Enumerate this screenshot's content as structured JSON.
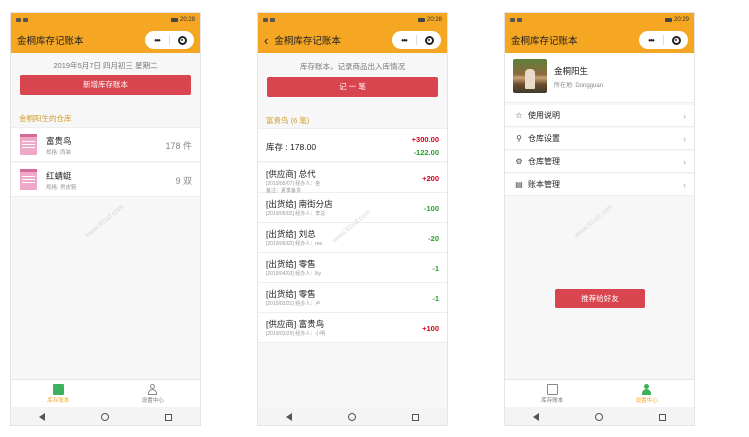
{
  "status_bar": {
    "carrier_glyphs": "⊡ ᵢₗ ≋",
    "right_glyphs": "⏰ ✱ ▮",
    "screen1_time": "20:28",
    "screen2_time": "20:28",
    "screen3_time": "20:29"
  },
  "capsule": {
    "more": "•••",
    "close_icon": "target-circle"
  },
  "screen1": {
    "title": "金桐库存记账本",
    "date": "2019年5月7日 四月初三 星期二",
    "add_button": "新增库存账本",
    "section": "金桐阳生的仓库",
    "items": [
      {
        "name": "富贵鸟",
        "spec": "规格: 西装",
        "qty": "178 件"
      },
      {
        "name": "红蜻蜓",
        "spec": "规格: 男皮鞋",
        "qty": "9 双"
      }
    ]
  },
  "screen2": {
    "title": "金桐库存记账本",
    "intro": "库存账本，记录商品出入库情况",
    "record_button": "记 一 笔",
    "section": "富贵鸟 (6 笔)",
    "stock_label": "库存 : 178.00",
    "stock_in": "+300.00",
    "stock_out": "-122.00",
    "records": [
      {
        "title": "[供应商] 总代",
        "meta": "[2019/05/07] 经办人：金",
        "meta2": "备注：夏季备货",
        "qty": "+200",
        "dir": "pos"
      },
      {
        "title": "[出货给] 南街分店",
        "meta": "[2019/05/02] 经办人：李总",
        "meta2": "",
        "qty": "-100",
        "dir": "neg"
      },
      {
        "title": "[出货给] 刘总",
        "meta": "[2019/05/02] 经办人：me",
        "meta2": "",
        "qty": "-20",
        "dir": "neg"
      },
      {
        "title": "[出货给] 零售",
        "meta": "[2019/04/03] 经办人：lily",
        "meta2": "",
        "qty": "-1",
        "dir": "neg"
      },
      {
        "title": "[出货给] 零售",
        "meta": "[2019/03/31] 经办人：卢",
        "meta2": "",
        "qty": "-1",
        "dir": "neg"
      },
      {
        "title": "[供应商] 富贵鸟",
        "meta": "[2019/03/29] 经办人：小明",
        "meta2": "",
        "qty": "+100",
        "dir": "pos"
      }
    ]
  },
  "screen3": {
    "title": "金桐库存记账本",
    "profile_name": "金桐阳生",
    "profile_location": "所在地: Dongguan",
    "menu": [
      {
        "label": "使用说明",
        "icon": "☆"
      },
      {
        "label": "仓库设置",
        "icon": "⚲"
      },
      {
        "label": "仓库管理",
        "icon": "⚙"
      },
      {
        "label": "账本管理",
        "icon": "▤"
      }
    ],
    "share_button": "推荐给好友"
  },
  "tabs": {
    "ledger": "库存账本",
    "settings": "设置中心"
  },
  "watermark": "www.91ud.com",
  "colors": {
    "header": "#f5a623",
    "button": "#d9454f",
    "income": "#d0021b",
    "expense": "#2a9d2a",
    "section": "#d09c2a"
  }
}
